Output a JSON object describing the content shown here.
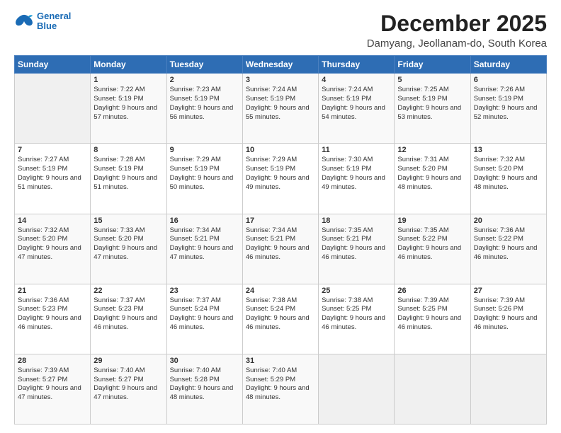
{
  "logo": {
    "line1": "General",
    "line2": "Blue"
  },
  "title": "December 2025",
  "location": "Damyang, Jeollanam-do, South Korea",
  "days_header": [
    "Sunday",
    "Monday",
    "Tuesday",
    "Wednesday",
    "Thursday",
    "Friday",
    "Saturday"
  ],
  "weeks": [
    [
      {
        "day": "",
        "empty": true
      },
      {
        "day": "1",
        "sunrise": "7:22 AM",
        "sunset": "5:19 PM",
        "daylight": "9 hours and 57 minutes."
      },
      {
        "day": "2",
        "sunrise": "7:23 AM",
        "sunset": "5:19 PM",
        "daylight": "9 hours and 56 minutes."
      },
      {
        "day": "3",
        "sunrise": "7:24 AM",
        "sunset": "5:19 PM",
        "daylight": "9 hours and 55 minutes."
      },
      {
        "day": "4",
        "sunrise": "7:24 AM",
        "sunset": "5:19 PM",
        "daylight": "9 hours and 54 minutes."
      },
      {
        "day": "5",
        "sunrise": "7:25 AM",
        "sunset": "5:19 PM",
        "daylight": "9 hours and 53 minutes."
      },
      {
        "day": "6",
        "sunrise": "7:26 AM",
        "sunset": "5:19 PM",
        "daylight": "9 hours and 52 minutes."
      }
    ],
    [
      {
        "day": "7",
        "sunrise": "7:27 AM",
        "sunset": "5:19 PM",
        "daylight": "9 hours and 51 minutes."
      },
      {
        "day": "8",
        "sunrise": "7:28 AM",
        "sunset": "5:19 PM",
        "daylight": "9 hours and 51 minutes."
      },
      {
        "day": "9",
        "sunrise": "7:29 AM",
        "sunset": "5:19 PM",
        "daylight": "9 hours and 50 minutes."
      },
      {
        "day": "10",
        "sunrise": "7:29 AM",
        "sunset": "5:19 PM",
        "daylight": "9 hours and 49 minutes."
      },
      {
        "day": "11",
        "sunrise": "7:30 AM",
        "sunset": "5:19 PM",
        "daylight": "9 hours and 49 minutes."
      },
      {
        "day": "12",
        "sunrise": "7:31 AM",
        "sunset": "5:20 PM",
        "daylight": "9 hours and 48 minutes."
      },
      {
        "day": "13",
        "sunrise": "7:32 AM",
        "sunset": "5:20 PM",
        "daylight": "9 hours and 48 minutes."
      }
    ],
    [
      {
        "day": "14",
        "sunrise": "7:32 AM",
        "sunset": "5:20 PM",
        "daylight": "9 hours and 47 minutes."
      },
      {
        "day": "15",
        "sunrise": "7:33 AM",
        "sunset": "5:20 PM",
        "daylight": "9 hours and 47 minutes."
      },
      {
        "day": "16",
        "sunrise": "7:34 AM",
        "sunset": "5:21 PM",
        "daylight": "9 hours and 47 minutes."
      },
      {
        "day": "17",
        "sunrise": "7:34 AM",
        "sunset": "5:21 PM",
        "daylight": "9 hours and 46 minutes."
      },
      {
        "day": "18",
        "sunrise": "7:35 AM",
        "sunset": "5:21 PM",
        "daylight": "9 hours and 46 minutes."
      },
      {
        "day": "19",
        "sunrise": "7:35 AM",
        "sunset": "5:22 PM",
        "daylight": "9 hours and 46 minutes."
      },
      {
        "day": "20",
        "sunrise": "7:36 AM",
        "sunset": "5:22 PM",
        "daylight": "9 hours and 46 minutes."
      }
    ],
    [
      {
        "day": "21",
        "sunrise": "7:36 AM",
        "sunset": "5:23 PM",
        "daylight": "9 hours and 46 minutes."
      },
      {
        "day": "22",
        "sunrise": "7:37 AM",
        "sunset": "5:23 PM",
        "daylight": "9 hours and 46 minutes."
      },
      {
        "day": "23",
        "sunrise": "7:37 AM",
        "sunset": "5:24 PM",
        "daylight": "9 hours and 46 minutes."
      },
      {
        "day": "24",
        "sunrise": "7:38 AM",
        "sunset": "5:24 PM",
        "daylight": "9 hours and 46 minutes."
      },
      {
        "day": "25",
        "sunrise": "7:38 AM",
        "sunset": "5:25 PM",
        "daylight": "9 hours and 46 minutes."
      },
      {
        "day": "26",
        "sunrise": "7:39 AM",
        "sunset": "5:25 PM",
        "daylight": "9 hours and 46 minutes."
      },
      {
        "day": "27",
        "sunrise": "7:39 AM",
        "sunset": "5:26 PM",
        "daylight": "9 hours and 46 minutes."
      }
    ],
    [
      {
        "day": "28",
        "sunrise": "7:39 AM",
        "sunset": "5:27 PM",
        "daylight": "9 hours and 47 minutes."
      },
      {
        "day": "29",
        "sunrise": "7:40 AM",
        "sunset": "5:27 PM",
        "daylight": "9 hours and 47 minutes."
      },
      {
        "day": "30",
        "sunrise": "7:40 AM",
        "sunset": "5:28 PM",
        "daylight": "9 hours and 48 minutes."
      },
      {
        "day": "31",
        "sunrise": "7:40 AM",
        "sunset": "5:29 PM",
        "daylight": "9 hours and 48 minutes."
      },
      {
        "day": "",
        "empty": true
      },
      {
        "day": "",
        "empty": true
      },
      {
        "day": "",
        "empty": true
      }
    ]
  ],
  "labels": {
    "sunrise": "Sunrise:",
    "sunset": "Sunset:",
    "daylight": "Daylight:"
  }
}
